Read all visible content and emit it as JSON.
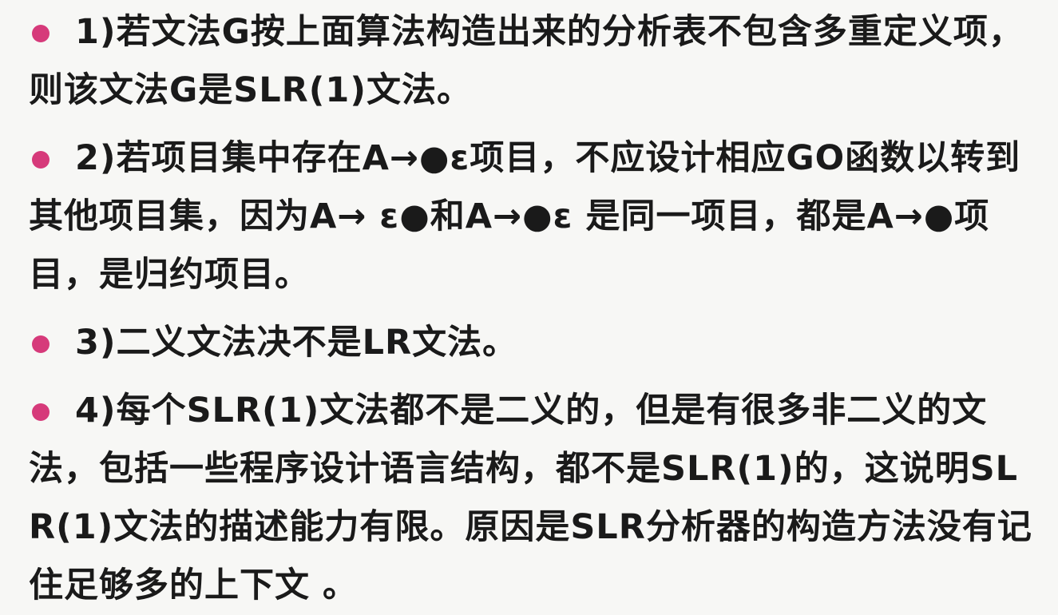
{
  "colors": {
    "background": "#f7f7f5",
    "text": "#1a1a1a",
    "bullet": "#d63a7a"
  },
  "items": [
    {
      "text": "1)若文法G按上面算法构造出来的分析表不包含多重定义项，则该文法G是SLR(1)文法。"
    },
    {
      "text": "2)若项目集中存在A→●ε项目，不应设计相应GO函数以转到其他项目集，因为A→ ε●和A→●ε 是同一项目，都是A→●项目，是归约项目。"
    },
    {
      "text": "3)二义文法决不是LR文法。"
    },
    {
      "text": "4)每个SLR(1)文法都不是二义的，但是有很多非二义的文法，包括一些程序设计语言结构，都不是SLR(1)的，这说明SLR(1)文法的描述能力有限。原因是SLR分析器的构造方法没有记住足够多的上下文 。"
    }
  ]
}
